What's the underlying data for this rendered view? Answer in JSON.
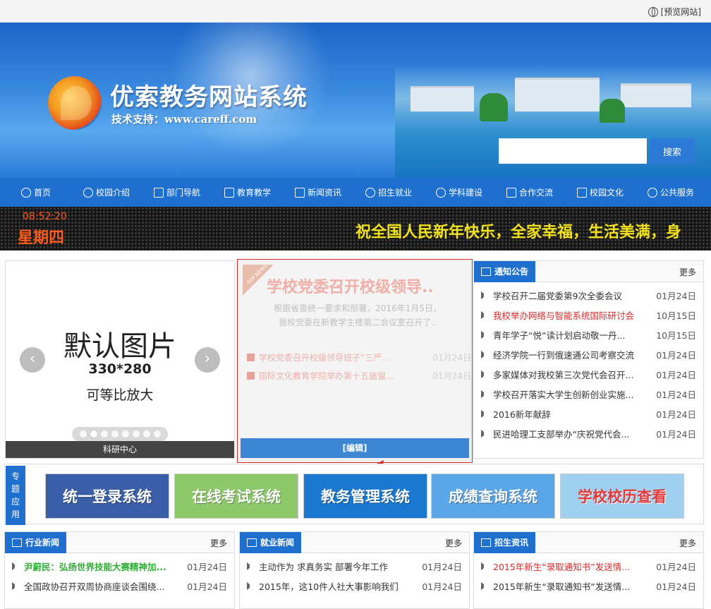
{
  "topbar": {
    "preview_label": "[预览网站]"
  },
  "header": {
    "title": "优索教务网站系统",
    "subtitle": "技术支持：www.careff.com"
  },
  "search": {
    "placeholder": "",
    "button": "搜索"
  },
  "nav": {
    "items": [
      {
        "label": "首页"
      },
      {
        "label": "校园介绍"
      },
      {
        "label": "部门导航"
      },
      {
        "label": "教育教学"
      },
      {
        "label": "新闻资讯"
      },
      {
        "label": "招生就业"
      },
      {
        "label": "学科建设"
      },
      {
        "label": "合作交流"
      },
      {
        "label": "校园文化"
      },
      {
        "label": "公共服务"
      }
    ]
  },
  "ticker": {
    "time": "08:52:20",
    "weekday": "星期四",
    "text": "祝全国人民新年快乐，全家幸福，生活美满，身"
  },
  "slider": {
    "big": "默认图片",
    "dim": "330*280",
    "note": "可等比放大",
    "caption": "科研中心",
    "prev": "‹",
    "next": "›"
  },
  "feature": {
    "ribbon": "TOP NEWS",
    "title": "学校党委召开校级领导..",
    "desc_line1": "根据省委统一要求和部署，2016年1月5日，",
    "desc_line2": "我校党委在新教学主楼第二会议室召开了..",
    "items": [
      {
        "title": "学校党委召开校级领导班子“三严...",
        "date": "01月24日"
      },
      {
        "title": "国际文化教育学院举办第十五届留...",
        "date": "01月24日"
      }
    ],
    "edit": "[编辑]"
  },
  "notice": {
    "tab": "通知公告",
    "more": "更多",
    "items": [
      {
        "title": "学校召开二届党委第9次全委会议",
        "date": "01月24日",
        "red": false
      },
      {
        "title": "我校举办网络与智能系统国际研讨会",
        "date": "10月15日",
        "red": true
      },
      {
        "title": "青年学子“悦”读计划启动敬一丹...",
        "date": "10月15日",
        "red": false
      },
      {
        "title": "经济学院一行到俄速通公司考察交流",
        "date": "01月24日",
        "red": false
      },
      {
        "title": "多家媒体对我校第三次党代会召开...",
        "date": "01月24日",
        "red": false
      },
      {
        "title": "学校召开落实大学生创新创业实施...",
        "date": "01月24日",
        "red": false
      },
      {
        "title": "2016新年献辞",
        "date": "01月24日",
        "red": false
      },
      {
        "title": "民进哈理工支部举办“庆祝党代会...",
        "date": "01月24日",
        "red": false
      }
    ]
  },
  "apps": {
    "label": [
      "专",
      "题",
      "应",
      "用"
    ],
    "items": [
      {
        "label": "统一登录系统",
        "color": "#3a5ea8"
      },
      {
        "label": "在线考试系统",
        "color": "#8dc96a"
      },
      {
        "label": "教务管理系统",
        "color": "#1a78d0"
      },
      {
        "label": "成绩查询系统",
        "color": "#5aa6e6"
      },
      {
        "label": "学校校历查看",
        "color": "#9fd0f0"
      }
    ]
  },
  "industry": {
    "tab": "行业新闻",
    "more": "更多",
    "items": [
      {
        "title": "尹蔚民：弘扬世界技能大赛精神加...",
        "date": "01月24日",
        "style": "green"
      },
      {
        "title": "全国政协召开双周协商座谈会围绕...",
        "date": "01月24日",
        "style": ""
      }
    ]
  },
  "employment": {
    "tab": "就业新闻",
    "more": "更多",
    "items": [
      {
        "title": "主动作为 求真务实 部署今年工作",
        "date": "01月24日",
        "style": ""
      },
      {
        "title": "2015年，这10件人社大事影响我们",
        "date": "01月24日",
        "style": ""
      }
    ]
  },
  "admission": {
    "tab": "招生资讯",
    "more": "更多",
    "items": [
      {
        "title": "2015年新生“录取通知书”发送情...",
        "date": "01月24日",
        "style": "red"
      },
      {
        "title": "2015年新生“录取通知书”发送情...",
        "date": "01月24日",
        "style": ""
      }
    ]
  }
}
